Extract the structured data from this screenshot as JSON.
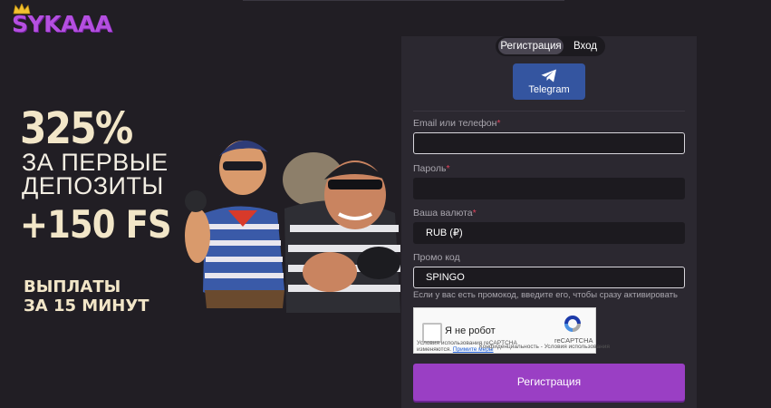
{
  "brand": {
    "name": "SYKAAA"
  },
  "promo": {
    "percent": "325%",
    "line1": "ЗА ПЕРВЫЕ",
    "line2": "ДЕПОЗИТЫ",
    "freespins": "+150 FS",
    "payout1": "ВЫПЛАТЫ",
    "payout2": "ЗА 15 МИНУТ"
  },
  "tabs": {
    "register": "Регистрация",
    "login": "Вход"
  },
  "telegram": {
    "label": "Telegram"
  },
  "form": {
    "email_label": "Email или телефон",
    "email_value": "",
    "password_label": "Пароль",
    "password_value": "",
    "currency_label": "Ваша валюта",
    "currency_value": "RUB (₽)",
    "promo_label": "Промо код",
    "promo_value": "SPINGO",
    "promo_hint": "Если у вас есть промокод, введите его, чтобы сразу активировать",
    "required_mark": "*"
  },
  "recaptcha": {
    "label": "Я не робот",
    "brand": "reCAPTCHA",
    "terms_line1": "Условия использования reCAPTCHA",
    "terms_line2": "изменяются.",
    "terms_link": "Примите меры",
    "privacy": "Конфиденциальность - Условия использования"
  },
  "submit_label": "Регистрация",
  "colors": {
    "accent": "#9a3fc4",
    "telegram": "#3455a0",
    "background": "#211e24",
    "required": "#e0425b"
  }
}
